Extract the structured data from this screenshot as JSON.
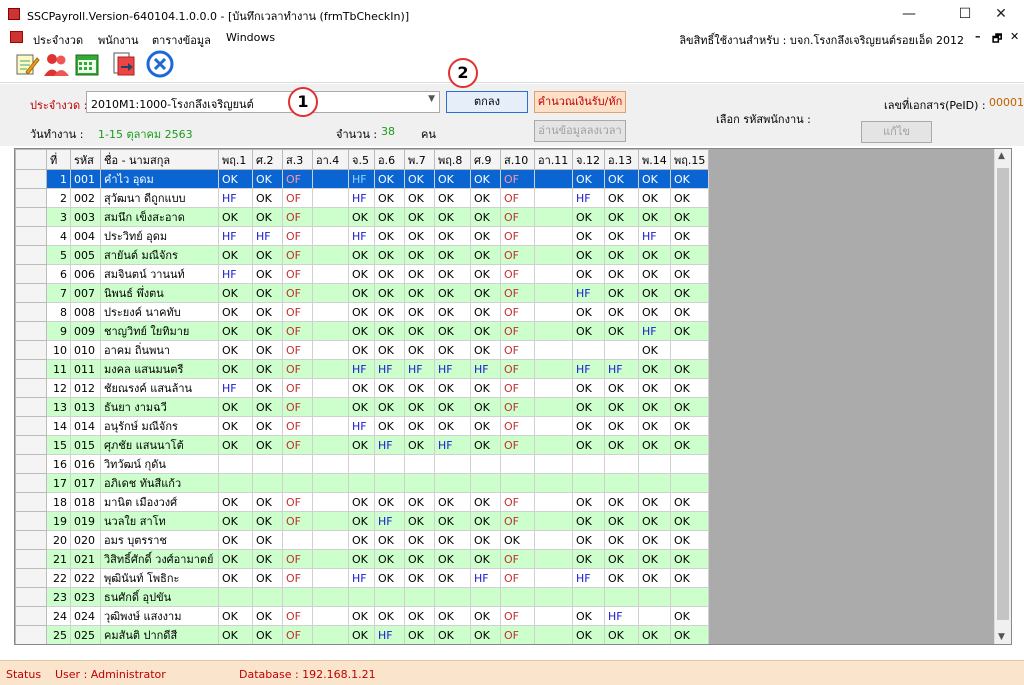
{
  "window": {
    "title": "SSCPayroll.Version-640104.1.0.0.0 - [บันทึกเวลาทำงาน (frmTbCheckIn)]",
    "min": "—",
    "max": "☐",
    "close": "✕"
  },
  "menu": {
    "items": [
      "ประจำงวด",
      "พนักงาน",
      "ตารางข้อมูล",
      "Windows"
    ],
    "rights": "ลิขสิทธิ์ใช้งานสำหรับ : บจก.โรงกลึงเจริญยนต์รอยเอ็ด 2012",
    "mdi_min": "–",
    "mdi_restore": "🗗",
    "mdi_close": "✕"
  },
  "toolbar": {
    "icons": [
      "edit-notes-icon",
      "users-icon",
      "calendar-icon",
      "export-icon",
      "close-circle-icon"
    ]
  },
  "form": {
    "period_label": "ประจำงวด :",
    "period_value": "2010M1:1000-โรงกลึงเจริญยนต์",
    "ok_button": "ตกลง",
    "calc_button": "คำนวณเงินรับ/หัก",
    "read_button": "อ่านข้อมูลลงเวลา",
    "doc_label": "เลขที่เอกสาร(PeID) :",
    "doc_value": "000012",
    "select_emp_label": "เลือก รหัสพนักงาน :",
    "edit_button": "แก้ไข",
    "workday_label": "วันทำงาน :",
    "workday_value": "1-15 ตุลาคม 2563",
    "count_label": "จำนวน :",
    "count_value": "38",
    "count_unit": "คน",
    "marker1": "1",
    "marker2": "2"
  },
  "table": {
    "columns": [
      "ที่",
      "รหัส",
      "ชื่อ - นามสกุล",
      "พฤ.1",
      "ศ.2",
      "ส.3",
      "อา.4",
      "จ.5",
      "อ.6",
      "พ.7",
      "พฤ.8",
      "ศ.9",
      "ส.10",
      "อา.11",
      "จ.12",
      "อ.13",
      "พ.14",
      "พฤ.15"
    ],
    "rows": [
      {
        "no": "1",
        "code": "001",
        "name": "คำไว อุดม",
        "d": [
          "OK",
          "OK",
          "OF",
          "",
          "HF",
          "OK",
          "OK",
          "OK",
          "OK",
          "OF",
          "",
          "OK",
          "OK",
          "OK",
          "OK"
        ]
      },
      {
        "no": "2",
        "code": "002",
        "name": "สุวัฒนา  ดีถูกแบบ",
        "d": [
          "HF",
          "OK",
          "OF",
          "",
          "HF",
          "OK",
          "OK",
          "OK",
          "OK",
          "OF",
          "",
          "HF",
          "OK",
          "OK",
          "OK"
        ]
      },
      {
        "no": "3",
        "code": "003",
        "name": "สมนึก เข็งสะอาด",
        "d": [
          "OK",
          "OK",
          "OF",
          "",
          "OK",
          "OK",
          "OK",
          "OK",
          "OK",
          "OF",
          "",
          "OK",
          "OK",
          "OK",
          "OK"
        ]
      },
      {
        "no": "4",
        "code": "004",
        "name": "ประวิทย์ อุดม",
        "d": [
          "HF",
          "HF",
          "OF",
          "",
          "HF",
          "OK",
          "OK",
          "OK",
          "OK",
          "OF",
          "",
          "OK",
          "OK",
          "HF",
          "OK"
        ]
      },
      {
        "no": "5",
        "code": "005",
        "name": "สายันต์ มณีจักร",
        "d": [
          "OK",
          "OK",
          "OF",
          "",
          "OK",
          "OK",
          "OK",
          "OK",
          "OK",
          "OF",
          "",
          "OK",
          "OK",
          "OK",
          "OK"
        ]
      },
      {
        "no": "6",
        "code": "006",
        "name": "สมจินตน์ วานนท์",
        "d": [
          "HF",
          "OK",
          "OF",
          "",
          "OK",
          "OK",
          "OK",
          "OK",
          "OK",
          "OF",
          "",
          "OK",
          "OK",
          "OK",
          "OK"
        ]
      },
      {
        "no": "7",
        "code": "007",
        "name": "นิพนธ์   พึ่งตน",
        "d": [
          "OK",
          "OK",
          "OF",
          "",
          "OK",
          "OK",
          "OK",
          "OK",
          "OK",
          "OF",
          "",
          "HF",
          "OK",
          "OK",
          "OK"
        ]
      },
      {
        "no": "8",
        "code": "008",
        "name": "ประยงค์ นาคทับ",
        "d": [
          "OK",
          "OK",
          "OF",
          "",
          "OK",
          "OK",
          "OK",
          "OK",
          "OK",
          "OF",
          "",
          "OK",
          "OK",
          "OK",
          "OK"
        ]
      },
      {
        "no": "9",
        "code": "009",
        "name": "ชาญวิทย์ ใยทิมาย",
        "d": [
          "OK",
          "OK",
          "OF",
          "",
          "OK",
          "OK",
          "OK",
          "OK",
          "OK",
          "OF",
          "",
          "OK",
          "OK",
          "HF",
          "OK"
        ]
      },
      {
        "no": "10",
        "code": "010",
        "name": "อาคม ถิ่นพนา",
        "d": [
          "OK",
          "OK",
          "OF",
          "",
          "OK",
          "OK",
          "OK",
          "OK",
          "OK",
          "OF",
          "",
          "",
          "",
          "OK",
          ""
        ]
      },
      {
        "no": "11",
        "code": "011",
        "name": "มงคล แสนมนตรี",
        "d": [
          "OK",
          "OK",
          "OF",
          "",
          "HF",
          "HF",
          "HF",
          "HF",
          "HF",
          "OF",
          "",
          "HF",
          "HF",
          "OK",
          "OK"
        ]
      },
      {
        "no": "12",
        "code": "012",
        "name": "ชัยณรงค์ แสนล้าน",
        "d": [
          "HF",
          "OK",
          "OF",
          "",
          "OK",
          "OK",
          "OK",
          "OK",
          "OK",
          "OF",
          "",
          "OK",
          "OK",
          "OK",
          "OK"
        ]
      },
      {
        "no": "13",
        "code": "013",
        "name": "ธันยา งามฉวี",
        "d": [
          "OK",
          "OK",
          "OF",
          "",
          "OK",
          "OK",
          "OK",
          "OK",
          "OK",
          "OF",
          "",
          "OK",
          "OK",
          "OK",
          "OK"
        ]
      },
      {
        "no": "14",
        "code": "014",
        "name": "อนุรักษ์ มณีจักร",
        "d": [
          "OK",
          "OK",
          "OF",
          "",
          "HF",
          "OK",
          "OK",
          "OK",
          "OK",
          "OF",
          "",
          "OK",
          "OK",
          "OK",
          "OK"
        ]
      },
      {
        "no": "15",
        "code": "015",
        "name": "ศุภชัย แสนนาโต้",
        "d": [
          "OK",
          "OK",
          "OF",
          "",
          "OK",
          "HF",
          "OK",
          "HF",
          "OK",
          "OF",
          "",
          "OK",
          "OK",
          "OK",
          "OK"
        ]
      },
      {
        "no": "16",
        "code": "016",
        "name": "วิทวัฒน์ กุดัน",
        "d": [
          "",
          "",
          "",
          "",
          "",
          "",
          "",
          "",
          "",
          "",
          "",
          "",
          "",
          "",
          ""
        ]
      },
      {
        "no": "17",
        "code": "017",
        "name": "อภิเดช ทันสีแก้ว",
        "d": [
          "",
          "",
          "",
          "",
          "",
          "",
          "",
          "",
          "",
          "",
          "",
          "",
          "",
          "",
          ""
        ]
      },
      {
        "no": "18",
        "code": "018",
        "name": "มานิต เมืองวงศ์",
        "d": [
          "OK",
          "OK",
          "OF",
          "",
          "OK",
          "OK",
          "OK",
          "OK",
          "OK",
          "OF",
          "",
          "OK",
          "OK",
          "OK",
          "OK"
        ]
      },
      {
        "no": "19",
        "code": "019",
        "name": "นวลใย สาโท",
        "d": [
          "OK",
          "OK",
          "OF",
          "",
          "OK",
          "HF",
          "OK",
          "OK",
          "OK",
          "OF",
          "",
          "OK",
          "OK",
          "OK",
          "OK"
        ]
      },
      {
        "no": "20",
        "code": "020",
        "name": "อมร บุตรราช",
        "d": [
          "OK",
          "OK",
          "",
          "",
          "OK",
          "OK",
          "OK",
          "OK",
          "OK",
          "OK",
          "",
          "OK",
          "OK",
          "OK",
          "OK"
        ]
      },
      {
        "no": "21",
        "code": "021",
        "name": "วิสิทธิ์ศักดิ์ วงศ์อามาตย์",
        "d": [
          "OK",
          "OK",
          "OF",
          "",
          "OK",
          "OK",
          "OK",
          "OK",
          "OK",
          "OF",
          "",
          "OK",
          "OK",
          "OK",
          "OK"
        ]
      },
      {
        "no": "22",
        "code": "022",
        "name": "พุฒินันท์ โพธิกะ",
        "d": [
          "OK",
          "OK",
          "OF",
          "",
          "HF",
          "OK",
          "OK",
          "OK",
          "HF",
          "OF",
          "",
          "HF",
          "OK",
          "OK",
          "OK"
        ]
      },
      {
        "no": "23",
        "code": "023",
        "name": "ธนศักดิ์ อุปขัน",
        "d": [
          "",
          "",
          "",
          "",
          "",
          "",
          "",
          "",
          "",
          "",
          "",
          "",
          "",
          "",
          ""
        ]
      },
      {
        "no": "24",
        "code": "024",
        "name": "วุฒิพงษ์ แสงงาม",
        "d": [
          "OK",
          "OK",
          "OF",
          "",
          "OK",
          "OK",
          "OK",
          "OK",
          "OK",
          "OF",
          "",
          "OK",
          "HF",
          "",
          "OK"
        ]
      },
      {
        "no": "25",
        "code": "025",
        "name": "คมสันติ ปากดีสี",
        "d": [
          "OK",
          "OK",
          "OF",
          "",
          "OK",
          "HF",
          "OK",
          "OK",
          "OK",
          "OF",
          "",
          "OK",
          "OK",
          "OK",
          "OK"
        ]
      }
    ]
  },
  "status": {
    "label": "Status",
    "user": "User : Administrator",
    "database": "Database : 192.168.1.21"
  },
  "colors": {
    "selected_row": "#0a64d2",
    "alt_row": "#ccffcc",
    "status_bg": "#fbe4cc",
    "marker": "#e03030"
  }
}
